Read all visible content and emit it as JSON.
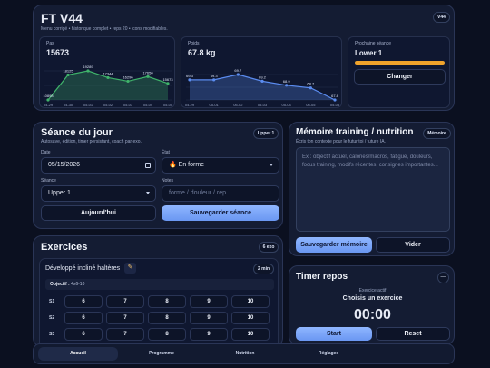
{
  "header": {
    "title": "FT V44",
    "subtitle": "Menu corrigé • historique complet • reps 20 • icons modifiables.",
    "badge": "V44"
  },
  "stats": {
    "pas": {
      "label": "Pas",
      "value": "15673",
      "chart_data": {
        "type": "area",
        "categories": [
          "04-29",
          "04-30",
          "05-01",
          "05-02",
          "05-03",
          "05-04",
          "05-05"
        ],
        "values": [
          10898,
          18125,
          19289,
          17344,
          16296,
          17650,
          15673
        ],
        "value_labels": [
          "10898",
          "18125",
          "19289",
          "17344",
          "16296",
          "17650",
          "15673"
        ],
        "color": "#3fb36a"
      }
    },
    "poids": {
      "label": "Poids",
      "value": "67.8 kg",
      "chart_data": {
        "type": "area",
        "categories": [
          "04-29",
          "05-01",
          "05-02",
          "05-03",
          "05-04",
          "05-05",
          "05-05"
        ],
        "values": [
          69.3,
          69.3,
          69.7,
          69.2,
          68.9,
          68.7,
          67.8
        ],
        "value_labels": [
          "69.3",
          "69.3",
          "69.7",
          "69.2",
          "68.9",
          "68.7",
          "67.8"
        ],
        "color": "#5b8cf0"
      }
    },
    "next": {
      "label": "Prochaine séance",
      "value": "Lower 1",
      "progress": 1.0,
      "button": "Changer"
    }
  },
  "seance": {
    "title": "Séance du jour",
    "subtitle": "Autosave, édition, timer persistant, coach par exo.",
    "badge": "Upper 1",
    "date_label": "Date",
    "date_value": "05/15/2026",
    "etat_label": "État",
    "etat_value": "🔥 En forme",
    "seance_label": "Séance",
    "seance_value": "Upper 1",
    "notes_label": "Notes",
    "notes_placeholder": "forme / douleur / rep",
    "today_button": "Aujourd'hui",
    "save_button": "Sauvegarder séance"
  },
  "memoire": {
    "title": "Mémoire training / nutrition",
    "subtitle": "Écris ton contexte pour le futur toi / future IA.",
    "badge": "Mémoire",
    "placeholder": "Ex : objectif actuel, calories/macros, fatigue, douleurs, focus training, modifs récentes, consignes importantes...",
    "save_button": "Sauvegarder mémoire",
    "clear_button": "Vider"
  },
  "exercices": {
    "title": "Exercices",
    "badge": "6 exo",
    "exercise_name": "Développé incliné haltères",
    "edit_icon": "pencil-icon",
    "rest_badge": "2 min",
    "objective_label": "Objectif :",
    "objective_value": "4x6-10",
    "sets": [
      {
        "label": "S1",
        "values": [
          "6",
          "7",
          "8",
          "9",
          "10"
        ]
      },
      {
        "label": "S2",
        "values": [
          "6",
          "7",
          "8",
          "9",
          "10"
        ]
      },
      {
        "label": "S3",
        "values": [
          "6",
          "7",
          "8",
          "9",
          "10"
        ]
      }
    ]
  },
  "timer": {
    "title": "Timer repos",
    "toggle": "—",
    "exercise_label": "Exercice actif",
    "exercise_value": "Choisis un exercice",
    "time": "00:00",
    "start": "Start",
    "reset": "Reset"
  },
  "nav": {
    "tabs": [
      "Accueil",
      "Programme",
      "Nutrition",
      "Réglages"
    ],
    "active": 0
  },
  "colors": {
    "accent": "#7aa3f8",
    "progress": "#f0a32b",
    "steps": "#3fb36a",
    "weight": "#5b8cf0"
  }
}
